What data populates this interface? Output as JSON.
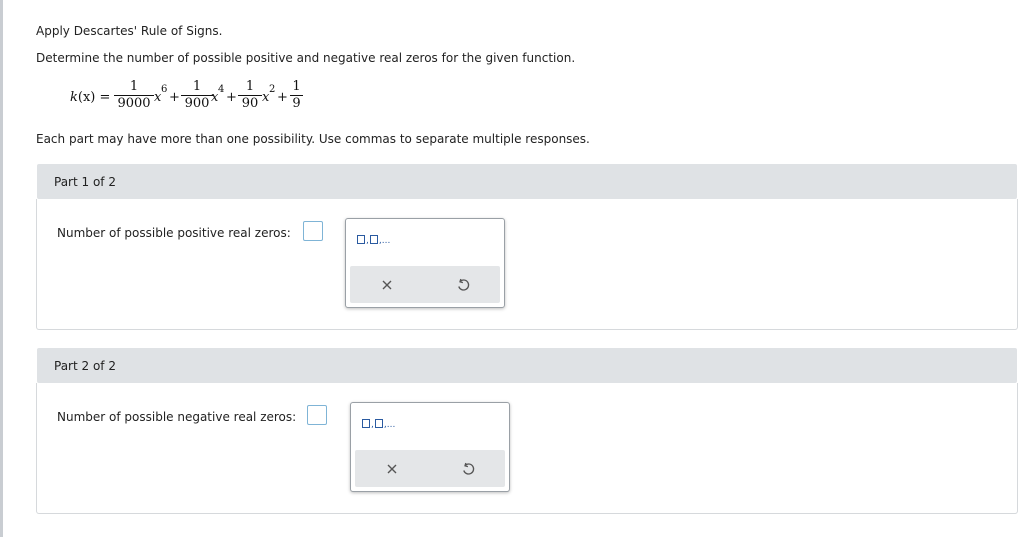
{
  "instructions": {
    "title": "Apply Descartes' Rule of Signs.",
    "prompt": "Determine the number of possible positive and negative real zeros for the given function.",
    "note": "Each part may have more than one possibility. Use commas to separate multiple responses."
  },
  "equation": {
    "lhs": "k(x) =",
    "lhs_func": "k",
    "lhs_arg": "(x)",
    "equals": "=",
    "var": "x",
    "plus": "+",
    "terms": [
      {
        "num": "1",
        "den": "9000",
        "exp": "6"
      },
      {
        "num": "1",
        "den": "900",
        "exp": "4"
      },
      {
        "num": "1",
        "den": "90",
        "exp": "2"
      },
      {
        "num": "1",
        "den": "9"
      }
    ]
  },
  "parts": [
    {
      "header": "Part 1 of 2",
      "label": "Number of possible positive real zeros:",
      "value": ""
    },
    {
      "header": "Part 2 of 2",
      "label": "Number of possible negative real zeros:",
      "value": ""
    }
  ],
  "palette": {
    "template_label": "□,□,...",
    "clear_icon": "x-icon",
    "undo_icon": "undo-icon"
  },
  "colors": {
    "header_bg": "#dfe2e5",
    "input_border": "#7fb4d6",
    "template_blue": "#2a5aa0"
  }
}
